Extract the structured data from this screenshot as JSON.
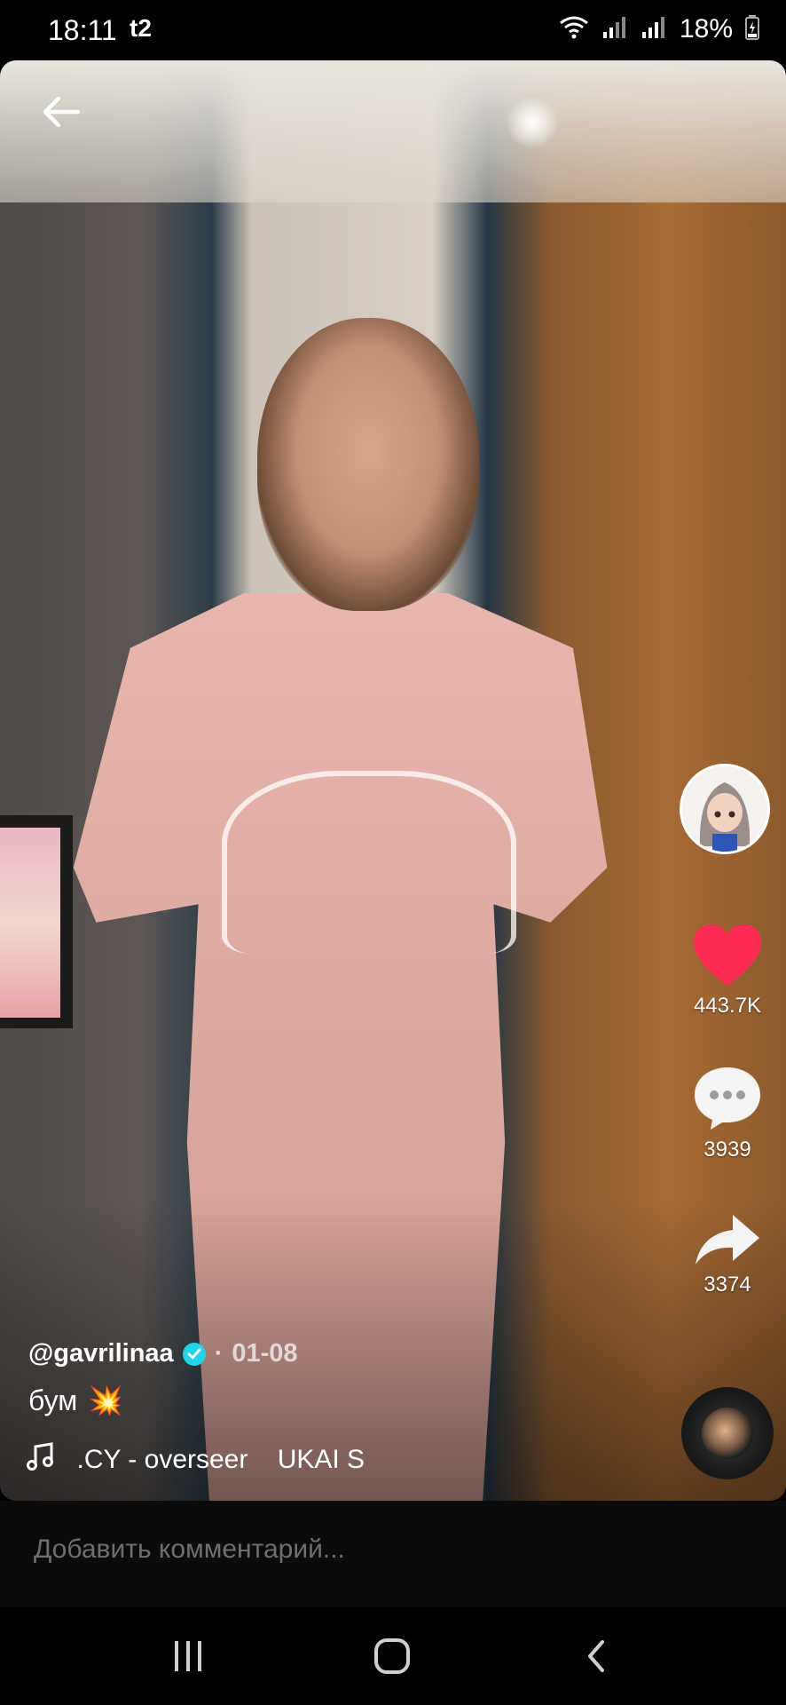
{
  "status_bar": {
    "time": "18:11",
    "carrier": "t2",
    "battery": "18%"
  },
  "post": {
    "author": "@gavrilinaa",
    "date_separator": "·",
    "date": "01-08",
    "caption_text": "бум",
    "caption_emoji": "💥",
    "music": " .CY - overseer    UKAI S"
  },
  "actions": {
    "likes": "443.7K",
    "comments": "3939",
    "shares": "3374"
  },
  "comment_bar": {
    "placeholder": "Добавить комментарий..."
  },
  "colors": {
    "like": "#fe2c55",
    "verified": "#20d5ec"
  },
  "icons": [
    "back-arrow-icon",
    "heart-icon",
    "comment-icon",
    "share-icon",
    "music-note-icon",
    "verified-icon",
    "wifi-icon",
    "signal-icon",
    "battery-icon"
  ]
}
